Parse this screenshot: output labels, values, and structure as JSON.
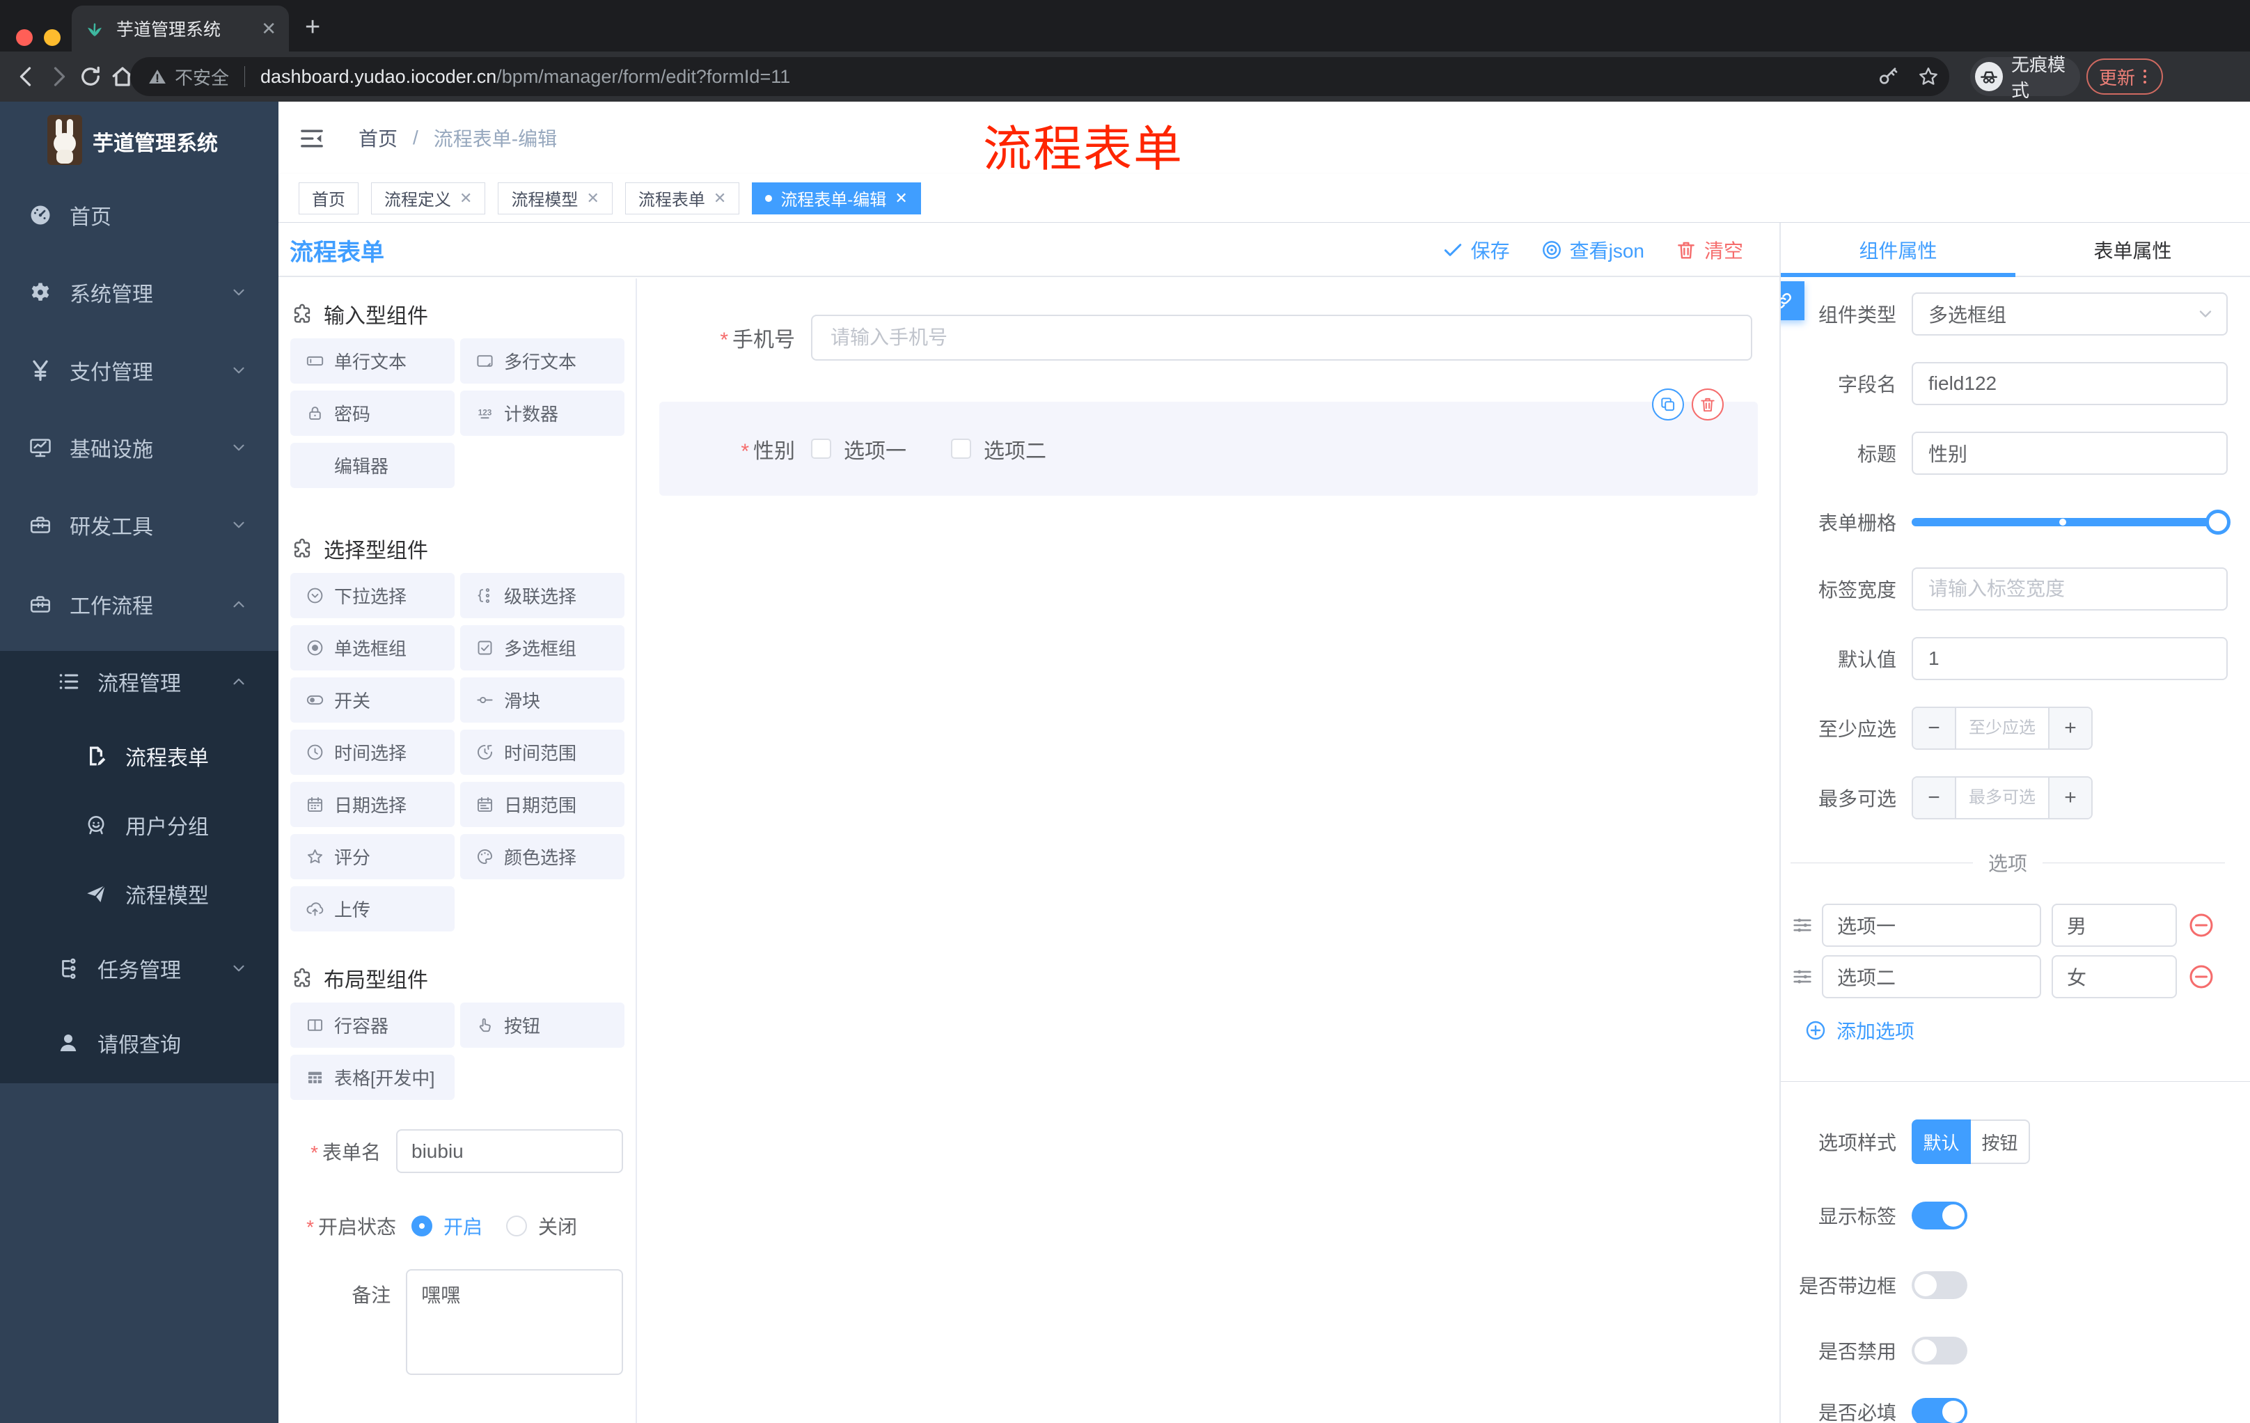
{
  "browser": {
    "tab_title": "芋道管理系统",
    "security_label": "不安全",
    "url_host": "dashboard.yudao.iocoder.cn",
    "url_path": "/bpm/manager/form/edit?formId=11",
    "incognito_label": "无痕模式",
    "update_label": "更新"
  },
  "sidebar": {
    "app_title": "芋道管理系统",
    "items": [
      {
        "label": "首页",
        "icon": "dashboard-icon"
      },
      {
        "label": "系统管理",
        "icon": "gear-icon"
      },
      {
        "label": "支付管理",
        "icon": "yen-icon"
      },
      {
        "label": "基础设施",
        "icon": "monitor-icon"
      },
      {
        "label": "研发工具",
        "icon": "toolbox-icon"
      },
      {
        "label": "工作流程",
        "icon": "toolbox-icon"
      },
      {
        "label": "流程管理",
        "icon": "list-icon"
      },
      {
        "label": "流程表单",
        "icon": "document-edit-icon"
      },
      {
        "label": "用户分组",
        "icon": "user-group-icon"
      },
      {
        "label": "流程模型",
        "icon": "paper-plane-icon"
      },
      {
        "label": "任务管理",
        "icon": "tree-icon"
      },
      {
        "label": "请假查询",
        "icon": "person-icon"
      }
    ]
  },
  "header": {
    "breadcrumb_home": "首页",
    "breadcrumb_sep": "/",
    "breadcrumb_current": "流程表单-编辑",
    "annotation": "流程表单"
  },
  "tags": [
    {
      "label": "首页"
    },
    {
      "label": "流程定义"
    },
    {
      "label": "流程模型"
    },
    {
      "label": "流程表单"
    },
    {
      "label": "流程表单-编辑"
    }
  ],
  "designer": {
    "title": "流程表单",
    "toolbar": {
      "save": "保存",
      "view_json": "查看json",
      "clear": "清空"
    },
    "palette": {
      "sections": [
        {
          "title": "输入型组件",
          "items": [
            {
              "label": "单行文本"
            },
            {
              "label": "多行文本"
            },
            {
              "label": "密码"
            },
            {
              "label": "计数器"
            },
            {
              "label": "编辑器"
            }
          ]
        },
        {
          "title": "选择型组件",
          "items": [
            {
              "label": "下拉选择"
            },
            {
              "label": "级联选择"
            },
            {
              "label": "单选框组"
            },
            {
              "label": "多选框组"
            },
            {
              "label": "开关"
            },
            {
              "label": "滑块"
            },
            {
              "label": "时间选择"
            },
            {
              "label": "时间范围"
            },
            {
              "label": "日期选择"
            },
            {
              "label": "日期范围"
            },
            {
              "label": "评分"
            },
            {
              "label": "颜色选择"
            },
            {
              "label": "上传"
            }
          ]
        },
        {
          "title": "布局型组件",
          "items": [
            {
              "label": "行容器"
            },
            {
              "label": "按钮"
            },
            {
              "label": "表格[开发中]"
            }
          ]
        }
      ]
    },
    "meta": {
      "form_name_label": "表单名",
      "form_name_value": "biubiu",
      "status_label": "开启状态",
      "status_on": "开启",
      "status_off": "关闭",
      "remark_label": "备注",
      "remark_value": "嘿嘿"
    },
    "canvas": {
      "phone_label": "手机号",
      "phone_placeholder": "请输入手机号",
      "gender_label": "性别",
      "gender_option1": "选项一",
      "gender_option2": "选项二"
    }
  },
  "props": {
    "tab_component": "组件属性",
    "tab_form": "表单属性",
    "component_type_label": "组件类型",
    "component_type_value": "多选框组",
    "field_name_label": "字段名",
    "field_name_value": "field122",
    "title_label": "标题",
    "title_value": "性别",
    "grid_label": "表单栅格",
    "label_width_label": "标签宽度",
    "label_width_placeholder": "请输入标签宽度",
    "default_label": "默认值",
    "default_value": "1",
    "min_label": "至少应选",
    "min_placeholder": "至少应选",
    "max_label": "最多可选",
    "max_placeholder": "最多可选",
    "options_title": "选项",
    "options": [
      {
        "label": "选项一",
        "value": "男"
      },
      {
        "label": "选项二",
        "value": "女"
      }
    ],
    "add_option": "添加选项",
    "option_style_label": "选项样式",
    "option_style_default": "默认",
    "option_style_button": "按钮",
    "show_label_label": "显示标签",
    "border_label": "是否带边框",
    "disabled_label": "是否禁用",
    "required_label": "是否必填"
  },
  "colors": {
    "primary": "#409eff",
    "danger": "#f56c6c",
    "annotation_red": "#fe2500",
    "sidebar_bg": "#304156",
    "sidebar_sub_bg": "#1f2d3d"
  }
}
